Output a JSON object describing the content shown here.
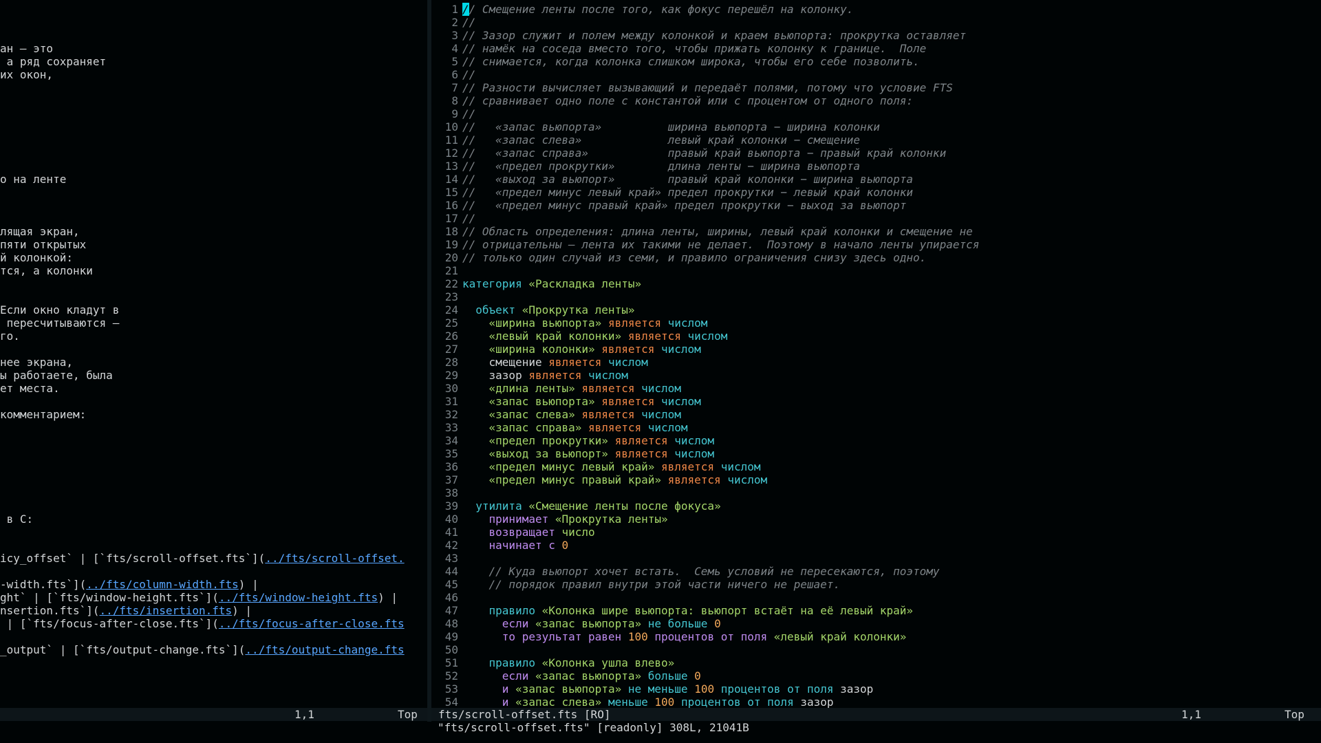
{
  "colors": {
    "background": "#000405",
    "comment": "#7d8488",
    "keyword": "#45c7d2",
    "keyword_purple": "#bf8cf0",
    "operator": "#ef8747",
    "string": "#a5d76a",
    "number": "#f2a85a",
    "link": "#58a6ff",
    "cursor": "#00d8e8",
    "statusline": "#0d1519"
  },
  "left_pane": {
    "lines": {
      "l4": "ан — это",
      "l5": " а ряд сохраняет",
      "l6": "их окон,",
      "l14": "о на ленте",
      "l18": "лящая экран,",
      "l19": "пяти открытых",
      "l20": "й колонкой:",
      "l21": "тся, а колонки",
      "l24": "Если окно кладут в",
      "l25": " пересчитываются —",
      "l26": "го.",
      "l28": "нее экрана,",
      "l29": "ы работаете, была",
      "l30": "ет места.",
      "l32": "комментарием:",
      "l40": " в C:",
      "l43": {
        "pre": "icy_offset` | [`fts/scroll-offset.fts`](",
        "link": "../fts/scroll-offset."
      },
      "l45": {
        "pre": "-width.fts`](",
        "link": "../fts/column-width.fts",
        "post": ") |"
      },
      "l46": {
        "pre": "ght` | [`fts/window-height.fts`](",
        "link": "../fts/window-height.fts",
        "post": ") |"
      },
      "l47": {
        "pre": "nsertion.fts`](",
        "link": "../fts/insertion.fts",
        "post": ") |"
      },
      "l48": {
        "pre": " | [`fts/focus-after-close.fts`](",
        "link": "../fts/focus-after-close.fts"
      },
      "l50": {
        "pre": "_output` | [`fts/output-change.fts`](",
        "link": "../fts/output-change.fts"
      }
    },
    "status": {
      "position": "1,1",
      "scroll": "Top"
    }
  },
  "right_pane": {
    "line_numbers": [
      "1",
      "2",
      "3",
      "4",
      "5",
      "6",
      "7",
      "8",
      "9",
      "10",
      "11",
      "12",
      "13",
      "14",
      "15",
      "16",
      "17",
      "18",
      "19",
      "20",
      "21",
      "22",
      "23",
      "24",
      "25",
      "26",
      "27",
      "28",
      "29",
      "30",
      "31",
      "32",
      "33",
      "34",
      "35",
      "36",
      "37",
      "38",
      "39",
      "40",
      "41",
      "42",
      "43",
      "44",
      "45",
      "46",
      "47",
      "48",
      "49",
      "50",
      "51",
      "52",
      "53",
      "54"
    ],
    "code": {
      "l1": {
        "cursor": "/",
        "rest": "/ Смещение ленты после того, как фокус перешёл на колонку."
      },
      "l2": "//",
      "l3": "// Зазор служит и полем между колонкой и краем вьюпорта: прокрутка оставляет",
      "l4": "// намёк на соседа вместо того, чтобы прижать колонку к границе.  Поле",
      "l5": "// снимается, когда колонка слишком широка, чтобы его себе позволить.",
      "l6": "//",
      "l7": "// Разности вычисляет вызывающий и передаёт полями, потому что условие FTS",
      "l8": "// сравнивает одно поле с константой или с процентом от одного поля:",
      "l9": "//",
      "l10": "//   «запас вьюпорта»          ширина вьюпорта − ширина колонки",
      "l11": "//   «запас слева»             левый край колонки − смещение",
      "l12": "//   «запас справа»            правый край вьюпорта − правый край колонки",
      "l13": "//   «предел прокрутки»        длина ленты − ширина вьюпорта",
      "l14": "//   «выход за вьюпорт»        правый край колонки − ширина вьюпорта",
      "l15": "//   «предел минус левый край» предел прокрутки − левый край колонки",
      "l16": "//   «предел минус правый край» предел прокрутки − выход за вьюпорт",
      "l17": "//",
      "l18": "// Область определения: длина ленты, ширины, левый край колонки и смещение не",
      "l19": "// отрицательны — лента их такими не делает.  Поэтому в начало ленты упирается",
      "l20": "// только один случай из семи, и правило ограничения снизу здесь одно.",
      "l22": {
        "kw": "категория",
        "str": "«Раскладка ленты»"
      },
      "l24": {
        "kw": "объект",
        "str": "«Прокрутка ленты»"
      },
      "l25": {
        "field": "«ширина вьюпорта»",
        "op": "является",
        "type": "числом"
      },
      "l26": {
        "field": "«левый край колонки»",
        "op": "является",
        "type": "числом"
      },
      "l27": {
        "field": "«ширина колонки»",
        "op": "является",
        "type": "числом"
      },
      "l28": {
        "field": "смещение",
        "op": "является",
        "type": "числом"
      },
      "l29": {
        "field": "зазор",
        "op": "является",
        "type": "числом"
      },
      "l30": {
        "field": "«длина ленты»",
        "op": "является",
        "type": "числом"
      },
      "l31": {
        "field": "«запас вьюпорта»",
        "op": "является",
        "type": "числом"
      },
      "l32": {
        "field": "«запас слева»",
        "op": "является",
        "type": "числом"
      },
      "l33": {
        "field": "«запас справа»",
        "op": "является",
        "type": "числом"
      },
      "l34": {
        "field": "«предел прокрутки»",
        "op": "является",
        "type": "числом"
      },
      "l35": {
        "field": "«выход за вьюпорт»",
        "op": "является",
        "type": "числом"
      },
      "l36": {
        "field": "«предел минус левый край»",
        "op": "является",
        "type": "числом"
      },
      "l37": {
        "field": "«предел минус правый край»",
        "op": "является",
        "type": "числом"
      },
      "l39": {
        "kw": "утилита",
        "str": "«Смещение ленты после фокуса»"
      },
      "l40": {
        "kw": "принимает",
        "str": "«Прокрутка ленты»"
      },
      "l41": {
        "kw": "возвращает",
        "type": "число"
      },
      "l42": {
        "kw": "начинает с",
        "num": "0"
      },
      "l44": "// Куда вьюпорт хочет встать.  Семь условий не пересекаются, поэтому",
      "l45": "// порядок правил внутри этой части ничего не решает.",
      "l47": {
        "kw": "правило",
        "str": "«Колонка шире вьюпорта: вьюпорт встаёт на её левый край»"
      },
      "l48": {
        "kw": "если",
        "str": "«запас вьюпорта»",
        "op": "не больше",
        "num": "0"
      },
      "l49": {
        "kw": "то результат равен",
        "num": "100",
        "kw2": "процентов от поля",
        "str": "«левый край колонки»"
      },
      "l51": {
        "kw": "правило",
        "str": "«Колонка ушла влево»"
      },
      "l52": {
        "kw": "если",
        "str": "«запас вьюпорта»",
        "op": "больше",
        "num": "0"
      },
      "l53": {
        "kw": "и",
        "str": "«запас вьюпорта»",
        "op": "не меньше",
        "num": "100",
        "kw2": "процентов от поля",
        "field": "зазор"
      },
      "l54": {
        "kw": "и",
        "str": "«запас слева»",
        "op": "меньше",
        "num": "100",
        "kw2": "процентов от поля",
        "field": "зазор"
      }
    },
    "status": {
      "file": "fts/scroll-offset.fts [RO]",
      "position": "1,1",
      "scroll": "Top"
    }
  },
  "message_line": "\"fts/scroll-offset.fts\" [readonly] 308L, 21041B"
}
